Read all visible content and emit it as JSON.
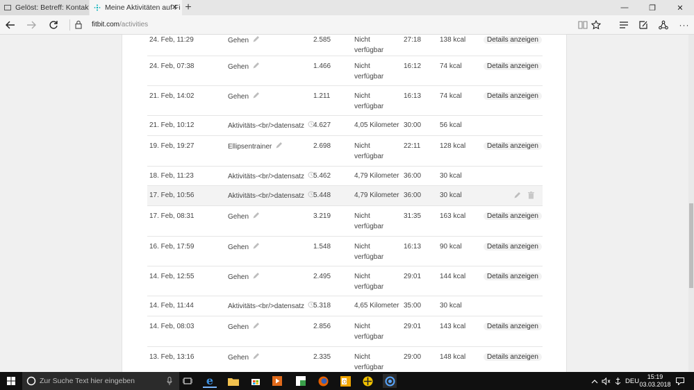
{
  "browser": {
    "tabs": [
      {
        "title": "Gelöst: Betreff: Kontakte nic",
        "active": false
      },
      {
        "title": "Meine Aktivitäten auf Fi",
        "active": true
      }
    ],
    "url_domain": "fitbit.com",
    "url_path": "/activities"
  },
  "activities": [
    {
      "date": "24. Feb, 11:29",
      "type": "Gehen",
      "steps": "2.585",
      "distance": [
        "Nicht",
        "verfügbar"
      ],
      "duration": "27:18",
      "calories": "138 kcal",
      "action": "Details anzeigen",
      "icon": "pencil-icon"
    },
    {
      "date": "24. Feb, 07:38",
      "type": "Gehen",
      "steps": "1.466",
      "distance": [
        "Nicht",
        "verfügbar"
      ],
      "duration": "16:12",
      "calories": "74 kcal",
      "action": "Details anzeigen",
      "icon": "pencil-icon"
    },
    {
      "date": "21. Feb, 14:02",
      "type": "Gehen",
      "steps": "1.211",
      "distance": [
        "Nicht",
        "verfügbar"
      ],
      "duration": "16:13",
      "calories": "74 kcal",
      "action": "Details anzeigen",
      "icon": "pencil-icon"
    },
    {
      "date": "21. Feb, 10:12",
      "type": "Aktivitäts-<br/>datensatz",
      "steps": "4.627",
      "distance": [
        "4,05 Kilometer"
      ],
      "duration": "30:00",
      "calories": "56 kcal",
      "action": "",
      "icon": "clock-icon"
    },
    {
      "date": "19. Feb, 19:27",
      "type": "Ellipsentrainer",
      "steps": "2.698",
      "distance": [
        "Nicht",
        "verfügbar"
      ],
      "duration": "22:11",
      "calories": "128 kcal",
      "action": "Details anzeigen",
      "icon": "pencil-icon"
    },
    {
      "date": "18. Feb, 11:23",
      "type": "Aktivitäts-<br/>datensatz",
      "steps": "5.462",
      "distance": [
        "4,79 Kilometer"
      ],
      "duration": "36:00",
      "calories": "30 kcal",
      "action": "",
      "icon": "clock-icon"
    },
    {
      "date": "17. Feb, 10:56",
      "type": "Aktivitäts-<br/>datensatz",
      "steps": "5.448",
      "distance": [
        "4,79 Kilometer"
      ],
      "duration": "36:00",
      "calories": "30 kcal",
      "action": "",
      "icon": "clock-icon",
      "highlight": true
    },
    {
      "date": "17. Feb, 08:31",
      "type": "Gehen",
      "steps": "3.219",
      "distance": [
        "Nicht",
        "verfügbar"
      ],
      "duration": "31:35",
      "calories": "163 kcal",
      "action": "Details anzeigen",
      "icon": "pencil-icon"
    },
    {
      "date": "16. Feb, 17:59",
      "type": "Gehen",
      "steps": "1.548",
      "distance": [
        "Nicht",
        "verfügbar"
      ],
      "duration": "16:13",
      "calories": "90 kcal",
      "action": "Details anzeigen",
      "icon": "pencil-icon"
    },
    {
      "date": "14. Feb, 12:55",
      "type": "Gehen",
      "steps": "2.495",
      "distance": [
        "Nicht",
        "verfügbar"
      ],
      "duration": "29:01",
      "calories": "144 kcal",
      "action": "Details anzeigen",
      "icon": "pencil-icon"
    },
    {
      "date": "14. Feb, 11:44",
      "type": "Aktivitäts-<br/>datensatz",
      "steps": "5.318",
      "distance": [
        "4,65 Kilometer"
      ],
      "duration": "35:00",
      "calories": "30 kcal",
      "action": "",
      "icon": "clock-icon"
    },
    {
      "date": "14. Feb, 08:03",
      "type": "Gehen",
      "steps": "2.856",
      "distance": [
        "Nicht",
        "verfügbar"
      ],
      "duration": "29:01",
      "calories": "143 kcal",
      "action": "Details anzeigen",
      "icon": "pencil-icon"
    },
    {
      "date": "13. Feb, 13:16",
      "type": "Gehen",
      "steps": "2.335",
      "distance": [
        "Nicht",
        "verfügbar"
      ],
      "duration": "29:00",
      "calories": "148 kcal",
      "action": "Details anzeigen",
      "icon": "pencil-icon"
    }
  ],
  "taskbar": {
    "search_placeholder": "Zur Suche Text hier eingeben",
    "language": "DEU",
    "time": "15:19",
    "date": "03.03.2018"
  }
}
